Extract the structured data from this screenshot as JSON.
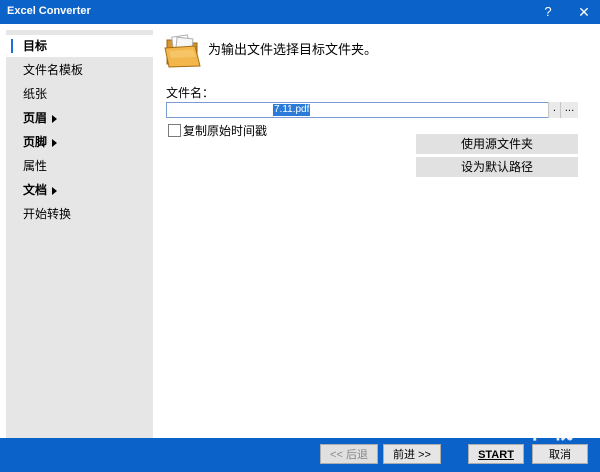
{
  "window": {
    "title": "Excel Converter",
    "help": "?",
    "close": "✕"
  },
  "sidebar": {
    "items": [
      {
        "label": "目标"
      },
      {
        "label": "文件名模板"
      },
      {
        "label": "纸张"
      },
      {
        "label": "页眉"
      },
      {
        "label": "页脚"
      },
      {
        "label": "属性"
      },
      {
        "label": "文档"
      },
      {
        "label": "开始转换"
      }
    ],
    "selected": "目标"
  },
  "main": {
    "heading": "为输出文件选择目标文件夹。",
    "filename_label": "文件名：",
    "filename_value": "7.11.pdf",
    "dot_button": ".",
    "ellipsis_button": "...",
    "keep_time_label": "复制原始时间戳",
    "keep_time_checked": false,
    "use_source_button": "使用源文件夹",
    "default_path_button": "设为默认路径"
  },
  "footer": {
    "back": "<< 后退",
    "next": "前进 >>",
    "start": "START",
    "cancel": "取消"
  },
  "watermark": "KK下载"
}
